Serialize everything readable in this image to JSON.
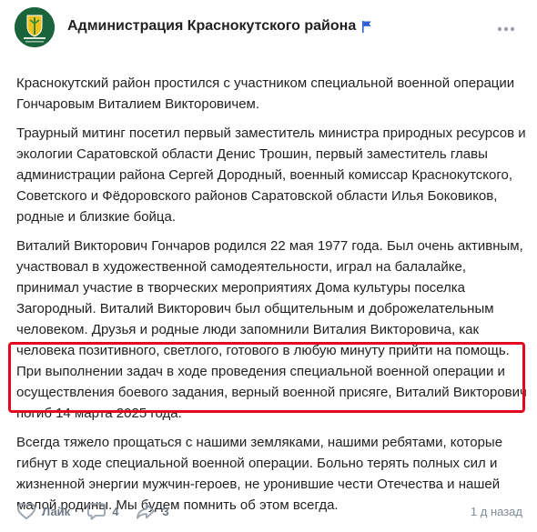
{
  "header": {
    "group_name": "Администрация Краснокутского района",
    "avatar_icon": "municipal-emblem-icon",
    "flag_icon": "blue-flag-icon",
    "more_icon": "more-icon"
  },
  "post": {
    "paragraphs": [
      "Краснокутский район простился с участником специальной военной операции Гончаровым Виталием Викторовичем.",
      "Траурный митинг посетил первый заместитель министра природных ресурсов и экологии Саратовской области Денис Трошин, первый заместитель главы администрации района Сергей Дородный, военный комиссар Краснокутского, Советского и Фёдоровского районов Саратовской области Илья Боковиков, родные и близкие бойца.",
      "Виталий Викторович Гончаров родился 22 мая 1977 года. Был очень активным, участвовал в художественной самодеятельности, играл на балалайке, принимал участие в творческих мероприятиях Дома культуры поселка Загородный. Виталий Викторович был общительным и доброжелательным человеком. Друзья и родные люди запомнили Виталия Викторовича, как человека позитивного, светлого, готового в любую минуту прийти на помощь. При выполнении задач в ходе проведения специальной военной операции и осуществления боевого задания, верный военной присяге, Виталий Викторович погиб 14 марта 2025 года.",
      "Всегда тяжело прощаться с нашими земляками, нашими ребятами, которые гибнут в ходе специальной военной операции. Больно терять полных сил и жизненной энергии мужчин-героев, не уронившие чести Отечества и нашей малой родины. Мы будем помнить об этом всегда."
    ]
  },
  "footer": {
    "like_label": "Лайк",
    "comments_count": "4",
    "shares_count": "3",
    "timestamp": "1 д назад"
  },
  "colors": {
    "highlight": "#e3061f",
    "avatar_bg": "#19643a",
    "flag": "#2a5fd6"
  }
}
